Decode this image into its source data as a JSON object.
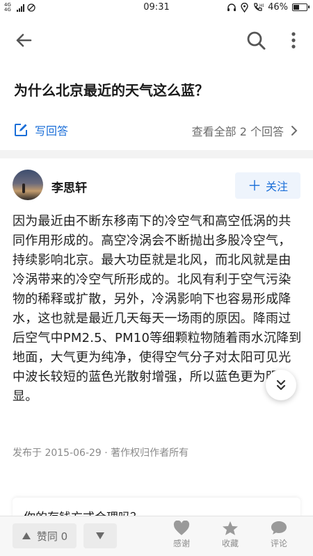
{
  "status_bar": {
    "network": "4G 4G",
    "time": "09:31",
    "battery_text": "46%",
    "battery_level": 0.46
  },
  "icons": {
    "back": "arrow-left-icon",
    "search": "search-icon",
    "more": "more-vertical-icon",
    "write": "edit-icon",
    "view_all": "chevron-right-icon",
    "scroll": "double-chevron-down-icon",
    "vote_up": "triangle-up-icon",
    "vote_down": "triangle-down-icon",
    "thanks": "heart-icon",
    "collect": "star-icon",
    "comment": "speech-bubble-icon"
  },
  "colors": {
    "accent": "#1a6ed8",
    "muted": "#8a8a8a"
  },
  "question": {
    "title": "为什么北京最近的天气这么蓝？",
    "write_answer_label": "写回答",
    "view_all_label": "查看全部 2 个回答"
  },
  "answer": {
    "author_name": "李思轩",
    "follow_label": "关注",
    "content": "因为最近由不断东移南下的冷空气和高空低涡的共同作用形成的。高空冷涡会不断抛出多股冷空气，持续影响北京。最大功臣就是北风，而北风就是由冷涡带来的冷空气所形成的。北风有利于空气污染物的稀释或扩散，另外，冷涡影响下也容易形成降水，这也就是最近几天每天一场雨的原因。降雨过后空气中PM2.5、PM10等细颗粒物随着雨水沉降到地面，大气更为纯净，使得空气分子对太阳可见光中波长较短的蓝色光散射增强，所以蓝色更为明显。",
    "meta": "发布于 2015-06-29 · 著作权归作者所有"
  },
  "next_card": {
    "text": "你的存钱方式合理吗？"
  },
  "bottom_bar": {
    "vote_up_label": "赞同 0",
    "thanks_label": "感谢",
    "collect_label": "收藏",
    "comment_label": "评论"
  }
}
